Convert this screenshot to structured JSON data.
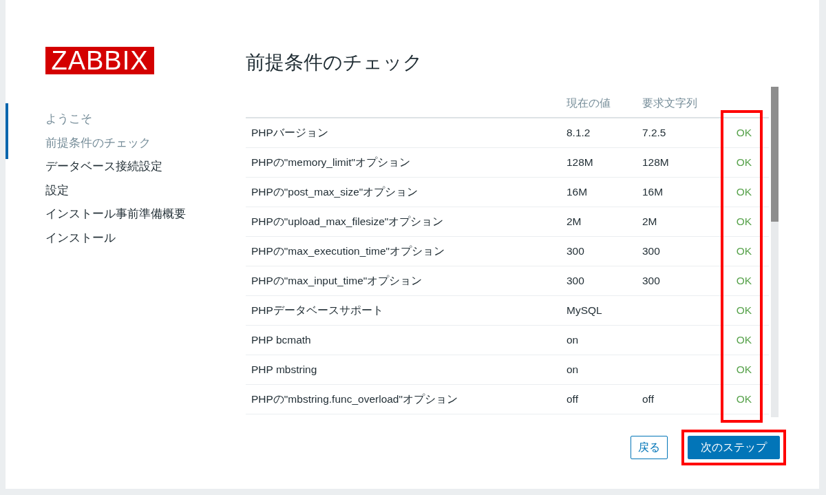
{
  "logo": {
    "text": "ZABBIX"
  },
  "sidebar": {
    "items": [
      {
        "label": "ようこそ",
        "completed": true
      },
      {
        "label": "前提条件のチェック",
        "completed": true
      },
      {
        "label": "データベース接続設定",
        "completed": false
      },
      {
        "label": "設定",
        "completed": false
      },
      {
        "label": "インストール事前準備概要",
        "completed": false
      },
      {
        "label": "インストール",
        "completed": false
      }
    ]
  },
  "title": "前提条件のチェック",
  "table": {
    "columns": {
      "current": "現在の値",
      "required": "要求文字列"
    },
    "rows": [
      {
        "name": "PHPバージョン",
        "current": "8.1.2",
        "required": "7.2.5",
        "status": "OK",
        "ok": true
      },
      {
        "name": "PHPの\"memory_limit\"オプション",
        "current": "128M",
        "required": "128M",
        "status": "OK",
        "ok": true
      },
      {
        "name": "PHPの\"post_max_size\"オプション",
        "current": "16M",
        "required": "16M",
        "status": "OK",
        "ok": true
      },
      {
        "name": "PHPの\"upload_max_filesize\"オプション",
        "current": "2M",
        "required": "2M",
        "status": "OK",
        "ok": true
      },
      {
        "name": "PHPの\"max_execution_time\"オプション",
        "current": "300",
        "required": "300",
        "status": "OK",
        "ok": true
      },
      {
        "name": "PHPの\"max_input_time\"オプション",
        "current": "300",
        "required": "300",
        "status": "OK",
        "ok": true
      },
      {
        "name": "PHPデータベースサポート",
        "current": "MySQL",
        "status": "OK",
        "ok": true
      },
      {
        "name": "PHP bcmath",
        "current": "on",
        "status": "OK",
        "ok": true
      },
      {
        "name": "PHP mbstring",
        "current": "on",
        "status": "OK",
        "ok": true
      },
      {
        "name": "PHPの\"mbstring.func_overload\"オプション",
        "current": "off",
        "required": "off",
        "status": "OK",
        "ok": true
      }
    ]
  },
  "buttons": {
    "back": "戻る",
    "next": "次のステップ"
  }
}
